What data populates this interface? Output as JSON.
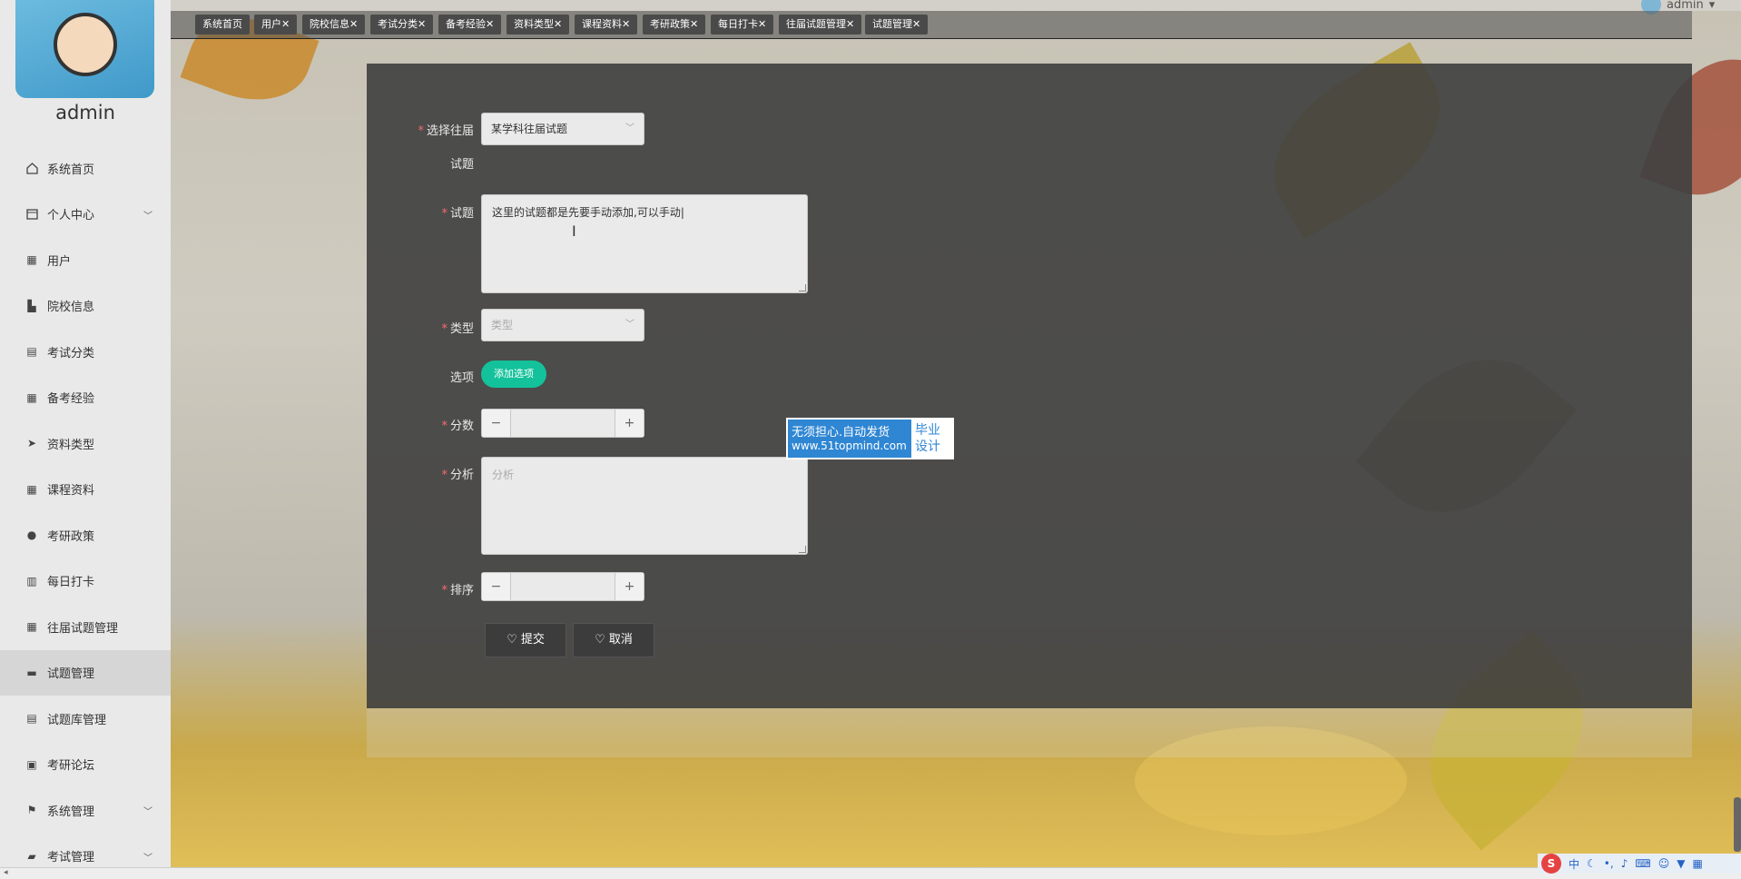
{
  "sidebar": {
    "username": "admin",
    "items": [
      {
        "label": "系统首页",
        "icon": "home-icon",
        "has_children": false
      },
      {
        "label": "个人中心",
        "icon": "calendar-icon",
        "has_children": true
      },
      {
        "label": "用户",
        "icon": "grid-icon",
        "has_children": false
      },
      {
        "label": "院校信息",
        "icon": "building-icon",
        "has_children": false
      },
      {
        "label": "考试分类",
        "icon": "clipboard-icon",
        "has_children": false
      },
      {
        "label": "备考经验",
        "icon": "grid-icon",
        "has_children": false
      },
      {
        "label": "资料类型",
        "icon": "send-icon",
        "has_children": false
      },
      {
        "label": "课程资料",
        "icon": "grid-icon",
        "has_children": false
      },
      {
        "label": "考研政策",
        "icon": "user-icon",
        "has_children": false
      },
      {
        "label": "每日打卡",
        "icon": "chart-icon",
        "has_children": false
      },
      {
        "label": "往届试题管理",
        "icon": "grid-icon",
        "has_children": false
      },
      {
        "label": "试题管理",
        "icon": "tag-icon",
        "has_children": false,
        "active": true
      },
      {
        "label": "试题库管理",
        "icon": "clipboard-icon",
        "has_children": false
      },
      {
        "label": "考研论坛",
        "icon": "briefcase-icon",
        "has_children": false
      },
      {
        "label": "系统管理",
        "icon": "flag-icon",
        "has_children": true
      },
      {
        "label": "考试管理",
        "icon": "chat-icon",
        "has_children": true
      }
    ]
  },
  "topbar": {
    "user": "admin"
  },
  "tabs": [
    {
      "label": "系统首页"
    },
    {
      "label": "用户✕"
    },
    {
      "label": "院校信息✕"
    },
    {
      "label": "考试分类✕"
    },
    {
      "label": "备考经验✕"
    },
    {
      "label": "资料类型✕"
    },
    {
      "label": "课程资料✕"
    },
    {
      "label": "考研政策✕"
    },
    {
      "label": "每日打卡✕"
    },
    {
      "label": "往届试题管理✕"
    },
    {
      "label": "试题管理✕"
    }
  ],
  "form": {
    "past_exam": {
      "label_line1": "选择往届",
      "label_line2": "试题",
      "value": "某学科往届试题"
    },
    "question": {
      "label": "试题",
      "value": "这里的试题都是先要手动添加,可以手动|"
    },
    "type": {
      "label": "类型",
      "placeholder": "类型"
    },
    "options": {
      "label": "选项",
      "add_button": "添加选项"
    },
    "score": {
      "label": "分数",
      "minus": "−",
      "plus": "+"
    },
    "analysis": {
      "label": "分析",
      "placeholder": "分析"
    },
    "sort": {
      "label": "排序",
      "minus": "−",
      "plus": "+"
    },
    "submit": "♡ 提交",
    "cancel": "♡ 取消",
    "required_mark": "*"
  },
  "watermark": {
    "line1": "无须担心.自动发货",
    "line2": "www.51topmind.com",
    "right": "毕业设计"
  },
  "ime": {
    "logo": "S",
    "mode": "中"
  },
  "colors": {
    "accent": "#13c29b",
    "required": "#f56c6c",
    "panel": "#3a3a3a"
  }
}
